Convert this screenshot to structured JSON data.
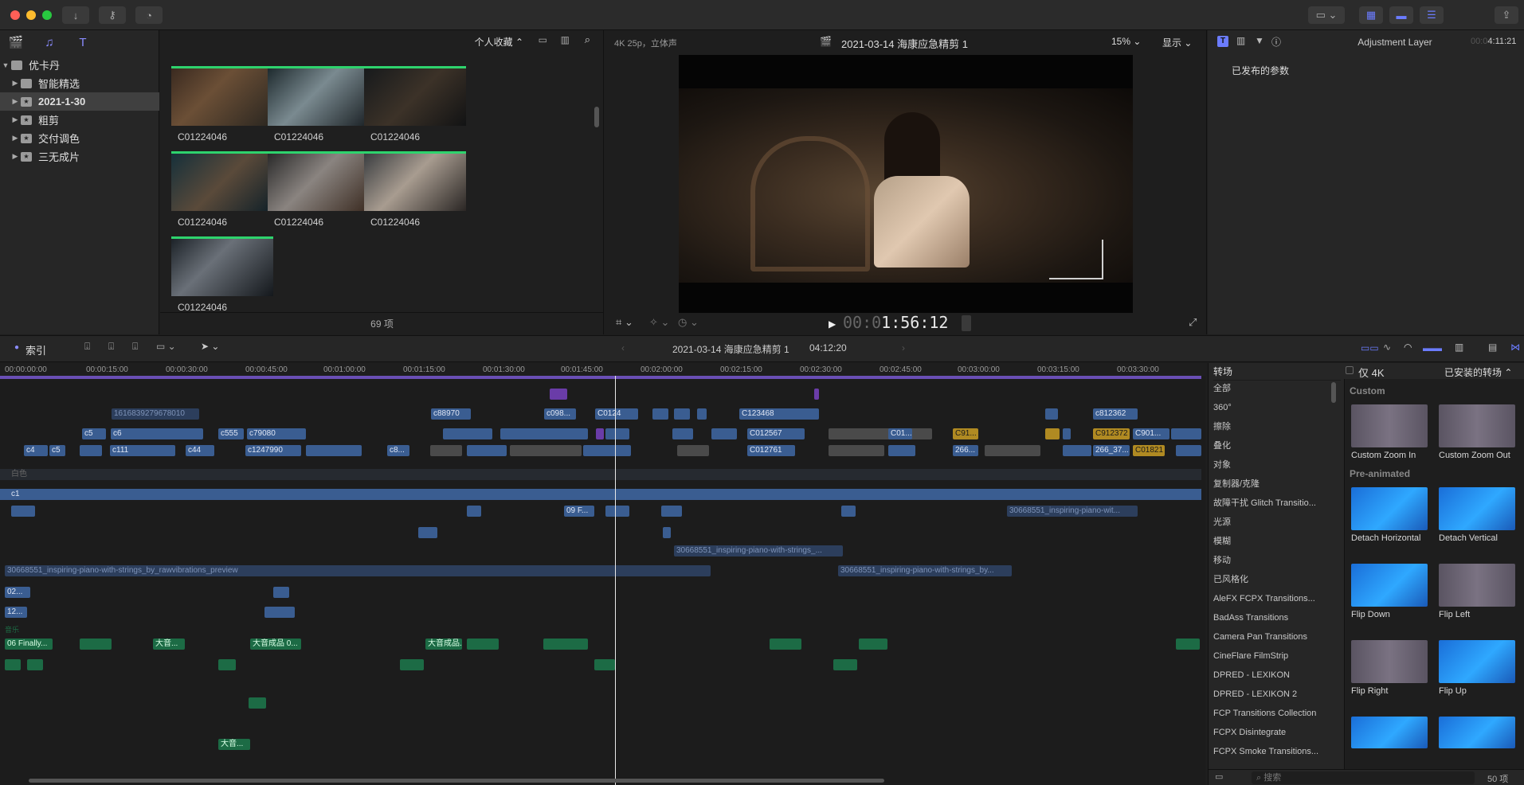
{
  "toolbar": {
    "colors": {
      "close": "#ff5f57",
      "min": "#febc2e",
      "max": "#28c840",
      "accent": "#6b7cff"
    }
  },
  "sidebar": {
    "library": "优卡丹",
    "items": [
      {
        "label": "智能精选"
      },
      {
        "label": "2021-1-30"
      },
      {
        "label": "粗剪"
      },
      {
        "label": "交付调色"
      },
      {
        "label": "三无成片"
      }
    ]
  },
  "browser": {
    "filter": "个人收藏",
    "clips": [
      "C01224046",
      "C01224046",
      "C01224046",
      "C01224046",
      "C01224046",
      "C01224046",
      "C01224046"
    ],
    "count": "69 项"
  },
  "viewer": {
    "format": "4K 25p，立体声",
    "title": "2021-03-14 海康应急精剪 1",
    "zoom": "15%",
    "display": "显示",
    "timecode_dim": "00:0",
    "timecode": "1:56:12"
  },
  "inspector": {
    "title": "Adjustment Layer",
    "time_dim": "00:0",
    "time": "4:11:21",
    "section": "已发布的参数"
  },
  "timeline": {
    "index_label": "索引",
    "project": "2021-03-14 海康应急精剪 1",
    "duration": "04:12:20",
    "ruler": [
      "00:00:00:00",
      "00:00:15:00",
      "00:00:30:00",
      "00:00:45:00",
      "00:01:00:00",
      "00:01:15:00",
      "00:01:30:00",
      "00:01:45:00",
      "00:02:00:00",
      "00:02:15:00",
      "00:02:30:00",
      "00:02:45:00",
      "00:03:00:00",
      "00:03:15:00",
      "00:03:30:00"
    ],
    "labels": {
      "c88970": "c88970",
      "c098": "c098...",
      "c0124": "C0124",
      "c123468": "C123468",
      "c812362": "c812362",
      "longid": "1616839279678010",
      "c5": "c5",
      "c6": "c6",
      "c555": "c555",
      "c79080": "c79080",
      "c012567": "C012567",
      "c01": "C01...",
      "c91": "C91...",
      "c912372": "C912372",
      "c901": "C901...",
      "c4": "c4",
      "c5b": "c5",
      "c111": "c111",
      "c44": "c44",
      "c1247990": "c1247990",
      "c8": "c8...",
      "c012761": "C012761",
      "n266": "266...",
      "n26637": "266_37...",
      "c01821": "C01821",
      "white": "白色",
      "c1": "c1",
      "music1": "30668551_inspiring-piano-with-strings_by_rawvibrations_preview",
      "music2": "30668551_inspiring-piano-with-strings_...",
      "music3": "30668551_inspiring-piano-with-strings_by...",
      "music4": "30668551_inspiring-piano-wit...",
      "n02": "02...",
      "n12": "12...",
      "f09": "09 F...",
      "music_label": "音乐",
      "finally": "06 Finally...",
      "big_sound": "大音成品...",
      "big": "大音...",
      "big0": "大音成品 0..."
    }
  },
  "transitions": {
    "title": "转场",
    "only4k": "仅 4K",
    "installed": "已安装的转场",
    "categories": [
      "全部",
      "360°",
      "擦除",
      "叠化",
      "对象",
      "复制器/克隆",
      "故障干扰 Glitch Transitio...",
      "光源",
      "模糊",
      "移动",
      "已风格化",
      "AleFX FCPX Transitions...",
      "BadAss Transitions",
      "Camera Pan Transitions",
      "CineFlare FilmStrip",
      "DPRED - LEXIKON",
      "DPRED - LEXIKON 2",
      "FCP Transitions Collection",
      "FCPX Disintegrate",
      "FCPX Smoke Transitions..."
    ],
    "custom_header": "Custom",
    "preanimated_header": "Pre-animated",
    "tiles": [
      "Custom Zoom In",
      "Custom Zoom Out",
      "Detach Horizontal",
      "Detach Vertical",
      "Flip Down",
      "Flip Left",
      "Flip Right",
      "Flip Up"
    ],
    "search_placeholder": "搜索",
    "count": "50 项"
  }
}
